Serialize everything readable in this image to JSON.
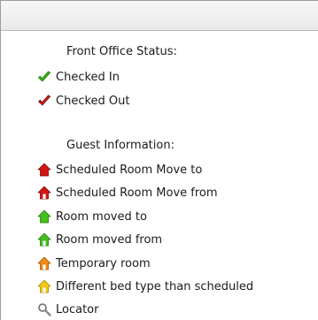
{
  "colors": {
    "green_check": "#3cb516",
    "red_check": "#c81e1e",
    "red_house": "#d41414",
    "green_house": "#44c01a",
    "orange_house": "#f08a12",
    "yellow_house": "#f2c916",
    "locator_gray": "#8a8a8a"
  },
  "front_office": {
    "title": "Front Office Status:",
    "items": [
      {
        "label": "Checked In",
        "icon": "green-check-icon"
      },
      {
        "label": "Checked Out",
        "icon": "red-check-icon"
      }
    ]
  },
  "guest_info": {
    "title": "Guest Information:",
    "items": [
      {
        "label": "Scheduled Room Move to",
        "icon": "red-house-solid-icon"
      },
      {
        "label": "Scheduled Room Move from",
        "icon": "red-house-outline-icon"
      },
      {
        "label": "Room moved to",
        "icon": "green-house-solid-icon"
      },
      {
        "label": "Room moved from",
        "icon": "green-house-outline-icon"
      },
      {
        "label": "Temporary room",
        "icon": "orange-house-icon"
      },
      {
        "label": "Different bed type than scheduled",
        "icon": "yellow-house-icon"
      },
      {
        "label": "Locator",
        "icon": "magnifier-icon"
      }
    ]
  }
}
